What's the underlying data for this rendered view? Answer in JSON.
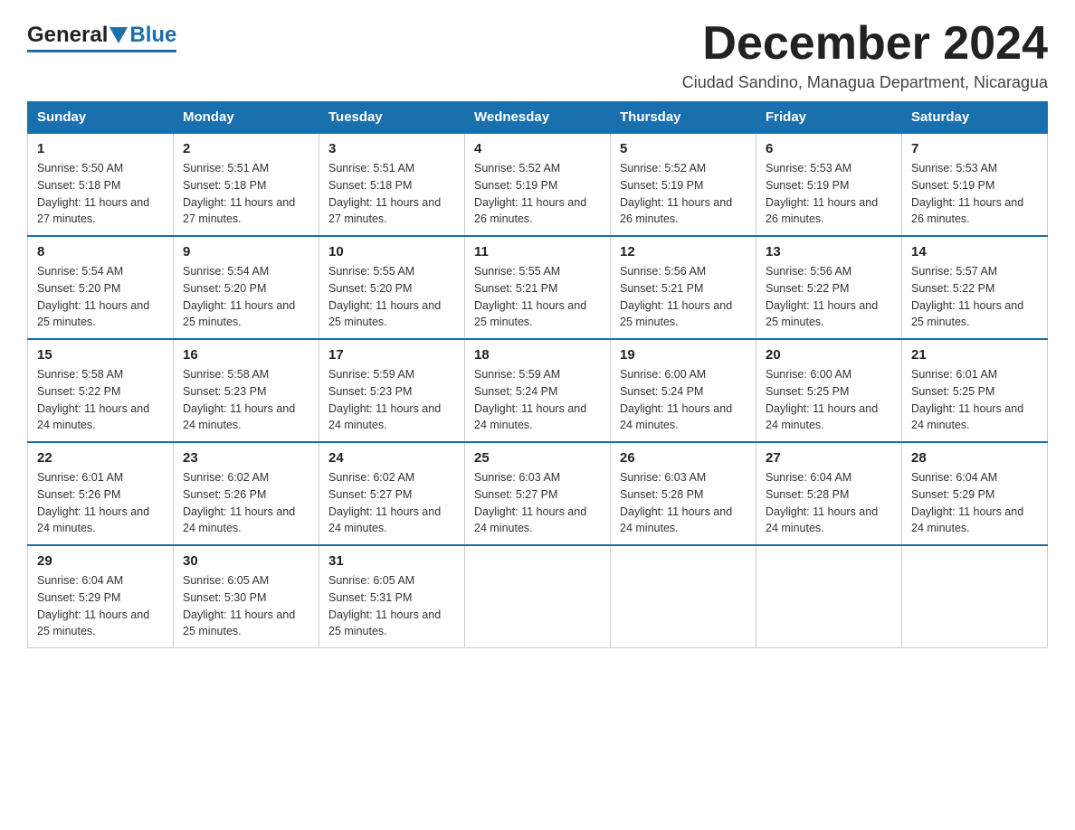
{
  "header": {
    "logo": {
      "general": "General",
      "blue": "Blue"
    },
    "month_title": "December 2024",
    "location": "Ciudad Sandino, Managua Department, Nicaragua"
  },
  "calendar": {
    "days_of_week": [
      "Sunday",
      "Monday",
      "Tuesday",
      "Wednesday",
      "Thursday",
      "Friday",
      "Saturday"
    ],
    "weeks": [
      [
        {
          "day": "1",
          "sunrise": "5:50 AM",
          "sunset": "5:18 PM",
          "daylight": "11 hours and 27 minutes."
        },
        {
          "day": "2",
          "sunrise": "5:51 AM",
          "sunset": "5:18 PM",
          "daylight": "11 hours and 27 minutes."
        },
        {
          "day": "3",
          "sunrise": "5:51 AM",
          "sunset": "5:18 PM",
          "daylight": "11 hours and 27 minutes."
        },
        {
          "day": "4",
          "sunrise": "5:52 AM",
          "sunset": "5:19 PM",
          "daylight": "11 hours and 26 minutes."
        },
        {
          "day": "5",
          "sunrise": "5:52 AM",
          "sunset": "5:19 PM",
          "daylight": "11 hours and 26 minutes."
        },
        {
          "day": "6",
          "sunrise": "5:53 AM",
          "sunset": "5:19 PM",
          "daylight": "11 hours and 26 minutes."
        },
        {
          "day": "7",
          "sunrise": "5:53 AM",
          "sunset": "5:19 PM",
          "daylight": "11 hours and 26 minutes."
        }
      ],
      [
        {
          "day": "8",
          "sunrise": "5:54 AM",
          "sunset": "5:20 PM",
          "daylight": "11 hours and 25 minutes."
        },
        {
          "day": "9",
          "sunrise": "5:54 AM",
          "sunset": "5:20 PM",
          "daylight": "11 hours and 25 minutes."
        },
        {
          "day": "10",
          "sunrise": "5:55 AM",
          "sunset": "5:20 PM",
          "daylight": "11 hours and 25 minutes."
        },
        {
          "day": "11",
          "sunrise": "5:55 AM",
          "sunset": "5:21 PM",
          "daylight": "11 hours and 25 minutes."
        },
        {
          "day": "12",
          "sunrise": "5:56 AM",
          "sunset": "5:21 PM",
          "daylight": "11 hours and 25 minutes."
        },
        {
          "day": "13",
          "sunrise": "5:56 AM",
          "sunset": "5:22 PM",
          "daylight": "11 hours and 25 minutes."
        },
        {
          "day": "14",
          "sunrise": "5:57 AM",
          "sunset": "5:22 PM",
          "daylight": "11 hours and 25 minutes."
        }
      ],
      [
        {
          "day": "15",
          "sunrise": "5:58 AM",
          "sunset": "5:22 PM",
          "daylight": "11 hours and 24 minutes."
        },
        {
          "day": "16",
          "sunrise": "5:58 AM",
          "sunset": "5:23 PM",
          "daylight": "11 hours and 24 minutes."
        },
        {
          "day": "17",
          "sunrise": "5:59 AM",
          "sunset": "5:23 PM",
          "daylight": "11 hours and 24 minutes."
        },
        {
          "day": "18",
          "sunrise": "5:59 AM",
          "sunset": "5:24 PM",
          "daylight": "11 hours and 24 minutes."
        },
        {
          "day": "19",
          "sunrise": "6:00 AM",
          "sunset": "5:24 PM",
          "daylight": "11 hours and 24 minutes."
        },
        {
          "day": "20",
          "sunrise": "6:00 AM",
          "sunset": "5:25 PM",
          "daylight": "11 hours and 24 minutes."
        },
        {
          "day": "21",
          "sunrise": "6:01 AM",
          "sunset": "5:25 PM",
          "daylight": "11 hours and 24 minutes."
        }
      ],
      [
        {
          "day": "22",
          "sunrise": "6:01 AM",
          "sunset": "5:26 PM",
          "daylight": "11 hours and 24 minutes."
        },
        {
          "day": "23",
          "sunrise": "6:02 AM",
          "sunset": "5:26 PM",
          "daylight": "11 hours and 24 minutes."
        },
        {
          "day": "24",
          "sunrise": "6:02 AM",
          "sunset": "5:27 PM",
          "daylight": "11 hours and 24 minutes."
        },
        {
          "day": "25",
          "sunrise": "6:03 AM",
          "sunset": "5:27 PM",
          "daylight": "11 hours and 24 minutes."
        },
        {
          "day": "26",
          "sunrise": "6:03 AM",
          "sunset": "5:28 PM",
          "daylight": "11 hours and 24 minutes."
        },
        {
          "day": "27",
          "sunrise": "6:04 AM",
          "sunset": "5:28 PM",
          "daylight": "11 hours and 24 minutes."
        },
        {
          "day": "28",
          "sunrise": "6:04 AM",
          "sunset": "5:29 PM",
          "daylight": "11 hours and 24 minutes."
        }
      ],
      [
        {
          "day": "29",
          "sunrise": "6:04 AM",
          "sunset": "5:29 PM",
          "daylight": "11 hours and 25 minutes."
        },
        {
          "day": "30",
          "sunrise": "6:05 AM",
          "sunset": "5:30 PM",
          "daylight": "11 hours and 25 minutes."
        },
        {
          "day": "31",
          "sunrise": "6:05 AM",
          "sunset": "5:31 PM",
          "daylight": "11 hours and 25 minutes."
        },
        null,
        null,
        null,
        null
      ]
    ]
  }
}
